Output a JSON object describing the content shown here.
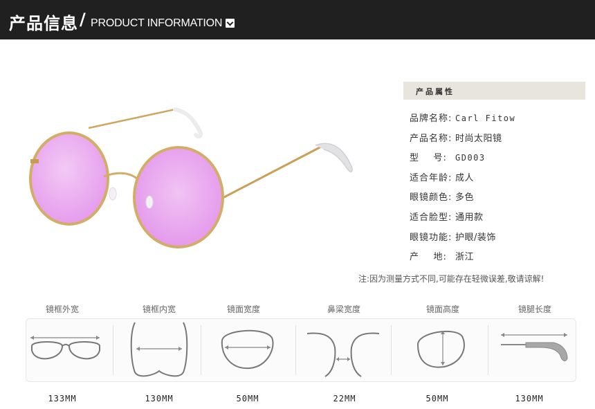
{
  "header": {
    "title_zh": "产品信息",
    "slash": "/",
    "title_en": "PRODUCT INFORMATION",
    "icon": "chevron-down-icon"
  },
  "colors": {
    "header_bg": "#202020",
    "frame_gold": "#d9b36a",
    "lens_pink": "#ebb6f0",
    "section_bar": "#e8e4de"
  },
  "attributes": {
    "heading": "产品属性",
    "items": [
      {
        "key": "品牌名称:",
        "value": "Carl Fitow"
      },
      {
        "key": "产品名称:",
        "value": "时尚太阳镜"
      },
      {
        "key": "型    号:",
        "value": "GD003"
      },
      {
        "key": "适合年龄:",
        "value": "成人"
      },
      {
        "key": "眼镜颜色:",
        "value": "多色"
      },
      {
        "key": "适合脸型:",
        "value": "通用款"
      },
      {
        "key": "眼镜功能:",
        "value": "护眼/装饰"
      },
      {
        "key": "产    地:",
        "value": "浙江"
      }
    ]
  },
  "note": "注:因为测量方式不同,可能存在轻微误差,敬请谅解!",
  "measurements": [
    {
      "label": "镜框外宽",
      "value": "133MM",
      "icon": "frame-outer-width-icon"
    },
    {
      "label": "镜框内宽",
      "value": "130MM",
      "icon": "frame-inner-width-icon"
    },
    {
      "label": "镜面宽度",
      "value": "50MM",
      "icon": "lens-width-icon"
    },
    {
      "label": "鼻梁宽度",
      "value": "22MM",
      "icon": "bridge-width-icon"
    },
    {
      "label": "镜面高度",
      "value": "50MM",
      "icon": "lens-height-icon"
    },
    {
      "label": "镜腿长度",
      "value": "130MM",
      "icon": "temple-length-icon"
    }
  ]
}
